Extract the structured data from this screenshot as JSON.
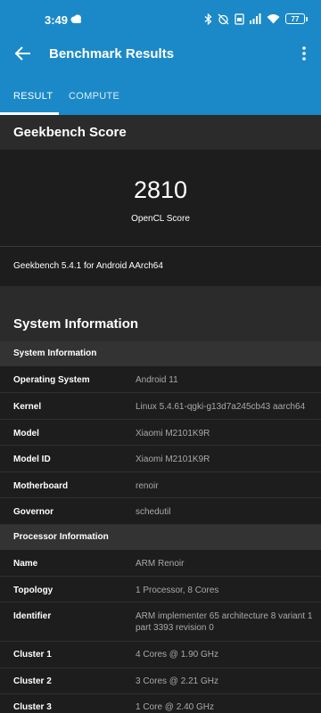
{
  "status": {
    "time": "3:49",
    "battery": "77"
  },
  "appbar": {
    "title": "Benchmark Results"
  },
  "tabs": [
    {
      "label": "RESULT"
    },
    {
      "label": "COMPUTE"
    }
  ],
  "geekbench": {
    "title": "Geekbench Score",
    "score": "2810",
    "score_label": "OpenCL Score",
    "version": "Geekbench 5.4.1 for Android AArch64"
  },
  "system_info": {
    "title": "System Information",
    "groups": [
      {
        "label": "System Information",
        "rows": [
          {
            "key": "Operating System",
            "value": "Android 11"
          },
          {
            "key": "Kernel",
            "value": "Linux 5.4.61-qgki-g13d7a245cb43 aarch64"
          },
          {
            "key": "Model",
            "value": "Xiaomi M2101K9R"
          },
          {
            "key": "Model ID",
            "value": "Xiaomi M2101K9R"
          },
          {
            "key": "Motherboard",
            "value": "renoir"
          },
          {
            "key": "Governor",
            "value": "schedutil"
          }
        ]
      },
      {
        "label": "Processor Information",
        "rows": [
          {
            "key": "Name",
            "value": "ARM Renoir"
          },
          {
            "key": "Topology",
            "value": "1 Processor, 8 Cores"
          },
          {
            "key": "Identifier",
            "value": "ARM implementer 65 architecture 8 variant 1 part 3393 revision 0"
          },
          {
            "key": "Cluster 1",
            "value": "4 Cores @ 1.90 GHz"
          },
          {
            "key": "Cluster 2",
            "value": "3 Cores @ 2.21 GHz"
          },
          {
            "key": "Cluster 3",
            "value": "1 Core @ 2.40 GHz"
          }
        ]
      }
    ]
  },
  "colors": {
    "accent": "#1b89c7",
    "background": "#1d1d1d",
    "header_bg": "#2b2b2b"
  }
}
